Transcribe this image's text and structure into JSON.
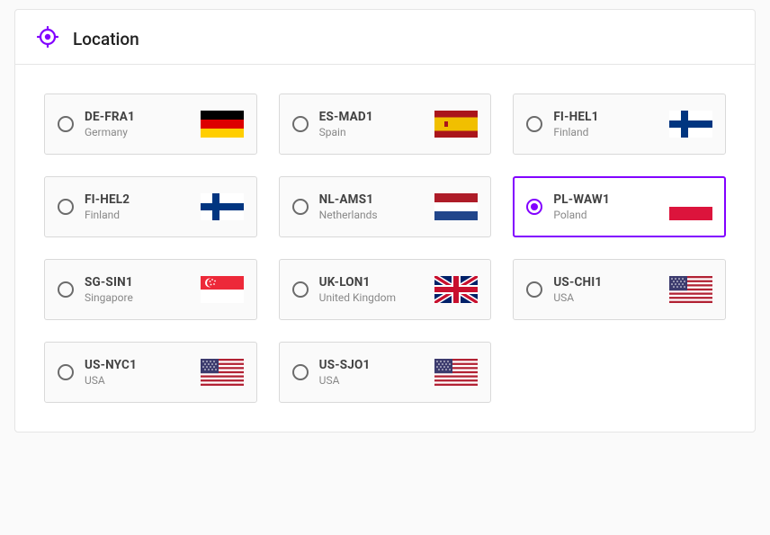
{
  "header": {
    "title": "Location",
    "icon": "location-target-icon"
  },
  "accent_color": "#8200ff",
  "locations": [
    {
      "code": "DE-FRA1",
      "country": "Germany",
      "flag": "de",
      "selected": false
    },
    {
      "code": "ES-MAD1",
      "country": "Spain",
      "flag": "es",
      "selected": false
    },
    {
      "code": "FI-HEL1",
      "country": "Finland",
      "flag": "fi",
      "selected": false
    },
    {
      "code": "FI-HEL2",
      "country": "Finland",
      "flag": "fi",
      "selected": false
    },
    {
      "code": "NL-AMS1",
      "country": "Netherlands",
      "flag": "nl",
      "selected": false
    },
    {
      "code": "PL-WAW1",
      "country": "Poland",
      "flag": "pl",
      "selected": true
    },
    {
      "code": "SG-SIN1",
      "country": "Singapore",
      "flag": "sg",
      "selected": false
    },
    {
      "code": "UK-LON1",
      "country": "United Kingdom",
      "flag": "gb",
      "selected": false
    },
    {
      "code": "US-CHI1",
      "country": "USA",
      "flag": "us",
      "selected": false
    },
    {
      "code": "US-NYC1",
      "country": "USA",
      "flag": "us",
      "selected": false
    },
    {
      "code": "US-SJO1",
      "country": "USA",
      "flag": "us",
      "selected": false
    }
  ]
}
